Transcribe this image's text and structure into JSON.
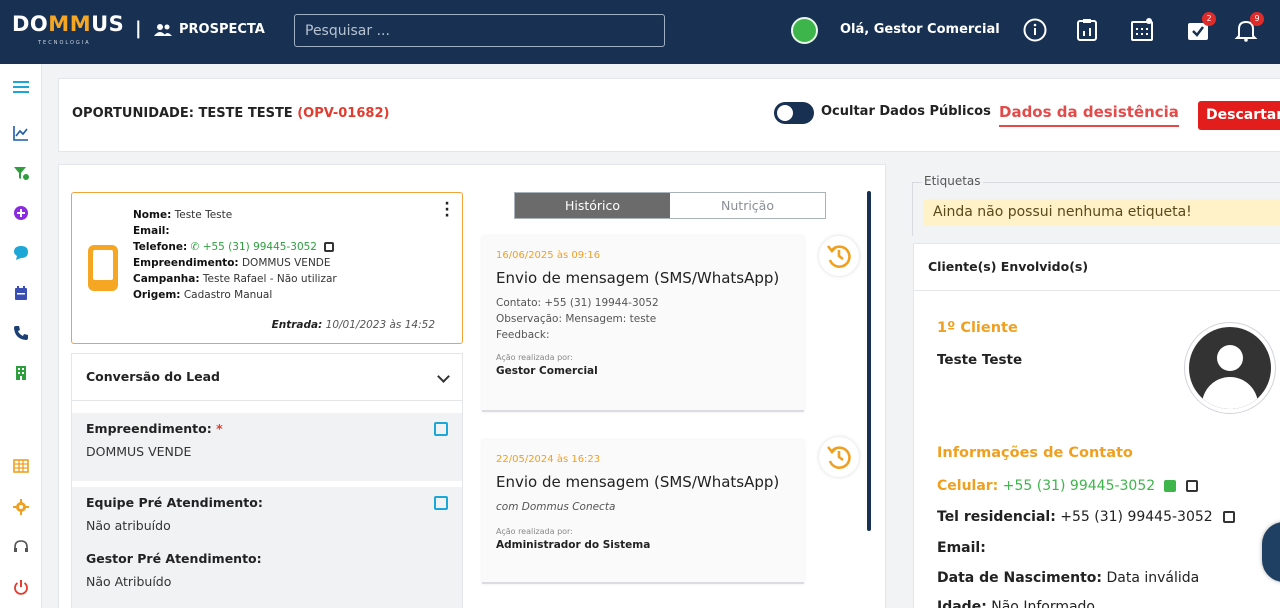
{
  "topbar": {
    "logo": "DOMMUS",
    "logo_pre": "DO",
    "logo_m": "MM",
    "logo_post": "US",
    "logo_sub": "TECNOLOGIA",
    "separator": "|",
    "module": "PROSPECTA",
    "search_placeholder": "Pesquisar ...",
    "greeting": "Olá, Gestor Comercial",
    "tasks_badge": "2",
    "notifications_badge": "9"
  },
  "header": {
    "title_prefix": "OPORTUNIDADE: TESTE TESTE",
    "code": "(OPV-01682)",
    "toggle_label": "Ocultar Dados Públicos",
    "desistencia": "Dados da desistência",
    "descartar": "Descartar"
  },
  "lead": {
    "nome_label": "Nome:",
    "nome": "Teste Teste",
    "email_label": "Email:",
    "telefone_label": "Telefone:",
    "telefone": "+55 (31) 99445-3052",
    "empreendimento_label": "Empreendimento:",
    "empreendimento": "DOMMUS VENDE",
    "campanha_label": "Campanha:",
    "campanha": "Teste Rafael - Não utilizar",
    "origem_label": "Origem:",
    "origem": "Cadastro Manual",
    "entrada_label": "Entrada:",
    "entrada": "10/01/2023 às 14:52"
  },
  "conversao": {
    "title": "Conversão do Lead",
    "sections": [
      {
        "label": "Empreendimento:",
        "required": "*",
        "value": "DOMMUS VENDE"
      },
      {
        "label": "Equipe Pré Atendimento:",
        "value": "Não atribuído"
      },
      {
        "label": "Gestor Pré Atendimento:",
        "value": "Não Atribuído"
      }
    ]
  },
  "tabs": {
    "historico": "Histórico",
    "nutricao": "Nutrição"
  },
  "timeline": [
    {
      "date": "16/06/2025 às 09:16",
      "title": "Envio de mensagem (SMS/WhatsApp)",
      "lines": [
        "Contato: +55 (31) 19944-3052",
        "Observação: Mensagem: teste",
        "Feedback:"
      ],
      "meta": "Ação realizada por:",
      "user": "Gestor Comercial"
    },
    {
      "date": "22/05/2024 às 16:23",
      "title": "Envio de mensagem (SMS/WhatsApp)",
      "subtitle": "com Dommus Conecta",
      "meta": "Ação realizada por:",
      "user": "Administrador do Sistema"
    }
  ],
  "etiquetas": {
    "legend": "Etiquetas",
    "empty": "Ainda não possui nenhuma etiqueta!"
  },
  "clientes": {
    "title": "Cliente(s) Envolvido(s)",
    "client_label": "1º Cliente",
    "name": "Teste Teste",
    "contact_title": "Informações de Contato",
    "celular_label": "Celular:",
    "celular": "+55 (31) 99445-3052",
    "tel_label": "Tel residencial:",
    "tel": "+55 (31) 99445-3052",
    "email_label": "Email:",
    "nascimento_label": "Data de Nascimento:",
    "nascimento": "Data inválida",
    "idade_label": "Idade:",
    "idade": "Não Informado"
  },
  "colors": {
    "navy": "#183153",
    "orange": "#f0a020",
    "red": "#e33b2e",
    "green": "#3db54a"
  }
}
